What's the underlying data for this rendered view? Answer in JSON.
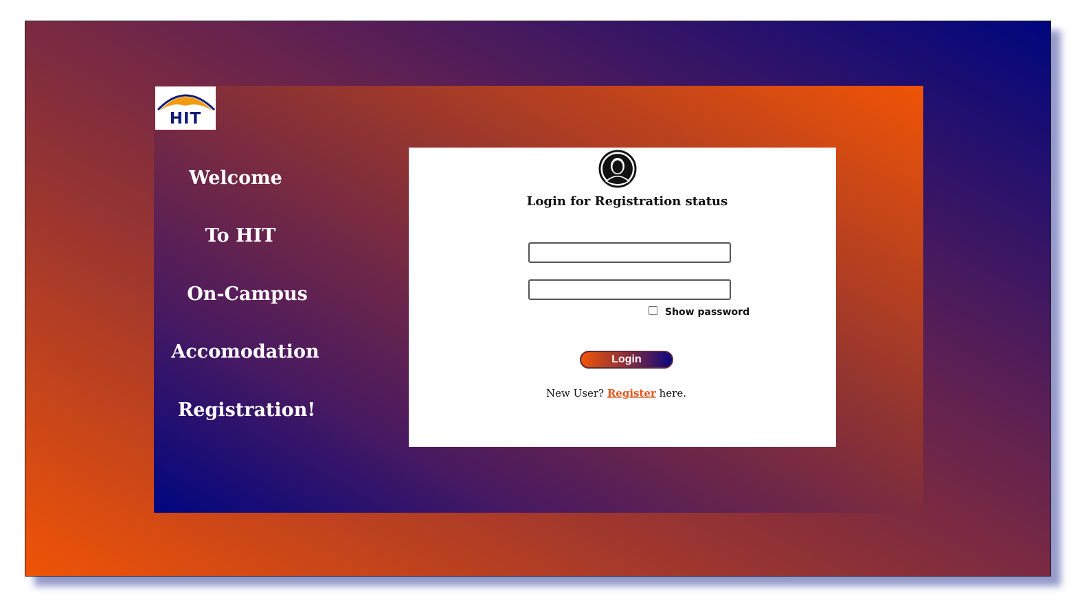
{
  "logo": {
    "text": "HIT"
  },
  "welcome": {
    "lines": [
      "Welcome",
      "To HIT",
      "On-Campus",
      "Accomodation",
      "Registration!"
    ]
  },
  "login": {
    "avatar_icon": "user-avatar-icon",
    "title": "Login for Registration status",
    "username_value": "",
    "password_value": "",
    "show_password_label": "Show password",
    "show_password_checked": false,
    "login_button_label": "Login",
    "new_user_prefix": "New User?",
    "register_link_label": "Register",
    "new_user_suffix": "here."
  },
  "colors": {
    "gradient_orange": "#f05406",
    "gradient_navy": "#00067e",
    "link_orange": "#e2571f",
    "card_background": "#ffffff"
  }
}
